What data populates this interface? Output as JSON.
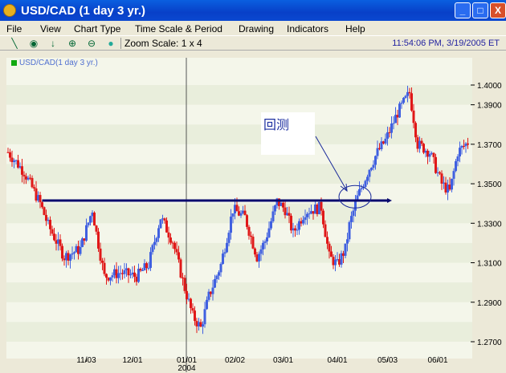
{
  "window": {
    "title": "USD/CAD (1 day  3 yr.)",
    "minimize": "_",
    "maximize": "□",
    "close": "X"
  },
  "menu": [
    "File",
    "View",
    "Chart Type",
    "Time Scale & Period",
    "Drawing",
    "Indicators",
    "Help"
  ],
  "toolbar": {
    "zoom_scale": "Zoom Scale: 1 x 4",
    "clock": "11:54:06 PM, 3/19/2005 ET"
  },
  "icons": [
    "pen-icon",
    "target-icon",
    "arrow-down-icon",
    "zoom-in-icon",
    "zoom-out-icon",
    "green-dot-icon"
  ],
  "annotation": {
    "text": "回测"
  },
  "colors": {
    "up": "#4060e0",
    "down": "#e01818",
    "line": "#0a0a6e"
  },
  "chart_data": {
    "type": "candlestick",
    "title": "USD/CAD(1 day  3 yr.)",
    "ylim": [
      1.265,
      1.415
    ],
    "y_ticks": [
      "1.4000",
      "1.3900",
      "1.3700",
      "1.3500",
      "1.3300",
      "1.3100",
      "1.2900",
      "1.2700"
    ],
    "x_ticks": [
      {
        "label": "11/03",
        "index": 39
      },
      {
        "label": "12/01",
        "index": 62
      },
      {
        "label": "01/01",
        "sub": "2004",
        "index": 89
      },
      {
        "label": "02/02",
        "index": 113
      },
      {
        "label": "03/01",
        "index": 137
      },
      {
        "label": "04/01",
        "index": 164
      },
      {
        "label": "05/03",
        "index": 189
      },
      {
        "label": "06/01",
        "index": 214
      }
    ],
    "n_days": 230,
    "close_anchors": [
      [
        0,
        1.366
      ],
      [
        8,
        1.356
      ],
      [
        16,
        1.34
      ],
      [
        20,
        1.329
      ],
      [
        28,
        1.313
      ],
      [
        36,
        1.317
      ],
      [
        42,
        1.337
      ],
      [
        44,
        1.325
      ],
      [
        48,
        1.303
      ],
      [
        56,
        1.305
      ],
      [
        64,
        1.303
      ],
      [
        70,
        1.309
      ],
      [
        76,
        1.333
      ],
      [
        82,
        1.321
      ],
      [
        88,
        1.297
      ],
      [
        92,
        1.283
      ],
      [
        96,
        1.277
      ],
      [
        100,
        1.293
      ],
      [
        106,
        1.309
      ],
      [
        112,
        1.337
      ],
      [
        118,
        1.333
      ],
      [
        124,
        1.313
      ],
      [
        128,
        1.321
      ],
      [
        134,
        1.341
      ],
      [
        138,
        1.337
      ],
      [
        142,
        1.325
      ],
      [
        148,
        1.336
      ],
      [
        156,
        1.338
      ],
      [
        160,
        1.313
      ],
      [
        164,
        1.309
      ],
      [
        168,
        1.317
      ],
      [
        170,
        1.329
      ],
      [
        174,
        1.343
      ],
      [
        180,
        1.358
      ],
      [
        184,
        1.366
      ],
      [
        188,
        1.372
      ],
      [
        194,
        1.386
      ],
      [
        200,
        1.396
      ],
      [
        204,
        1.37
      ],
      [
        210,
        1.366
      ],
      [
        216,
        1.35
      ],
      [
        220,
        1.346
      ],
      [
        224,
        1.366
      ],
      [
        230,
        1.372
      ]
    ],
    "support_line": {
      "price": 1.3415,
      "from_index": 17,
      "to_index": 190
    },
    "highlight": {
      "index": 174,
      "price": 1.343
    }
  }
}
